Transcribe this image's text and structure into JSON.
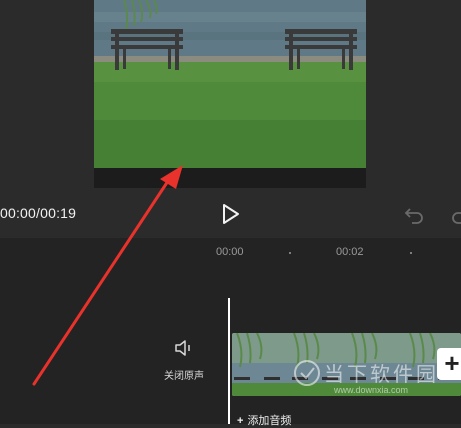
{
  "player": {
    "current_time": "00:00",
    "total_time": "00:19",
    "time_separator": "/",
    "timecode_text": "00:00/00:19"
  },
  "timeline": {
    "ruler_labels": [
      "00:00",
      "00:02"
    ],
    "mute_label": "关闭原声",
    "add_audio_label": "添加音频",
    "add_audio_plus": "+",
    "add_clip_plus": "+"
  },
  "watermark": {
    "text": "当下软件园",
    "url": "www.downxia.com"
  },
  "icons": {
    "play": "play-icon",
    "undo": "undo-icon",
    "redo": "redo-icon",
    "speaker": "speaker-icon"
  },
  "colors": {
    "background": "#2b2b2b",
    "timeline_background": "#232323",
    "annotation_arrow": "#e8322b",
    "playhead": "#ffffff"
  }
}
